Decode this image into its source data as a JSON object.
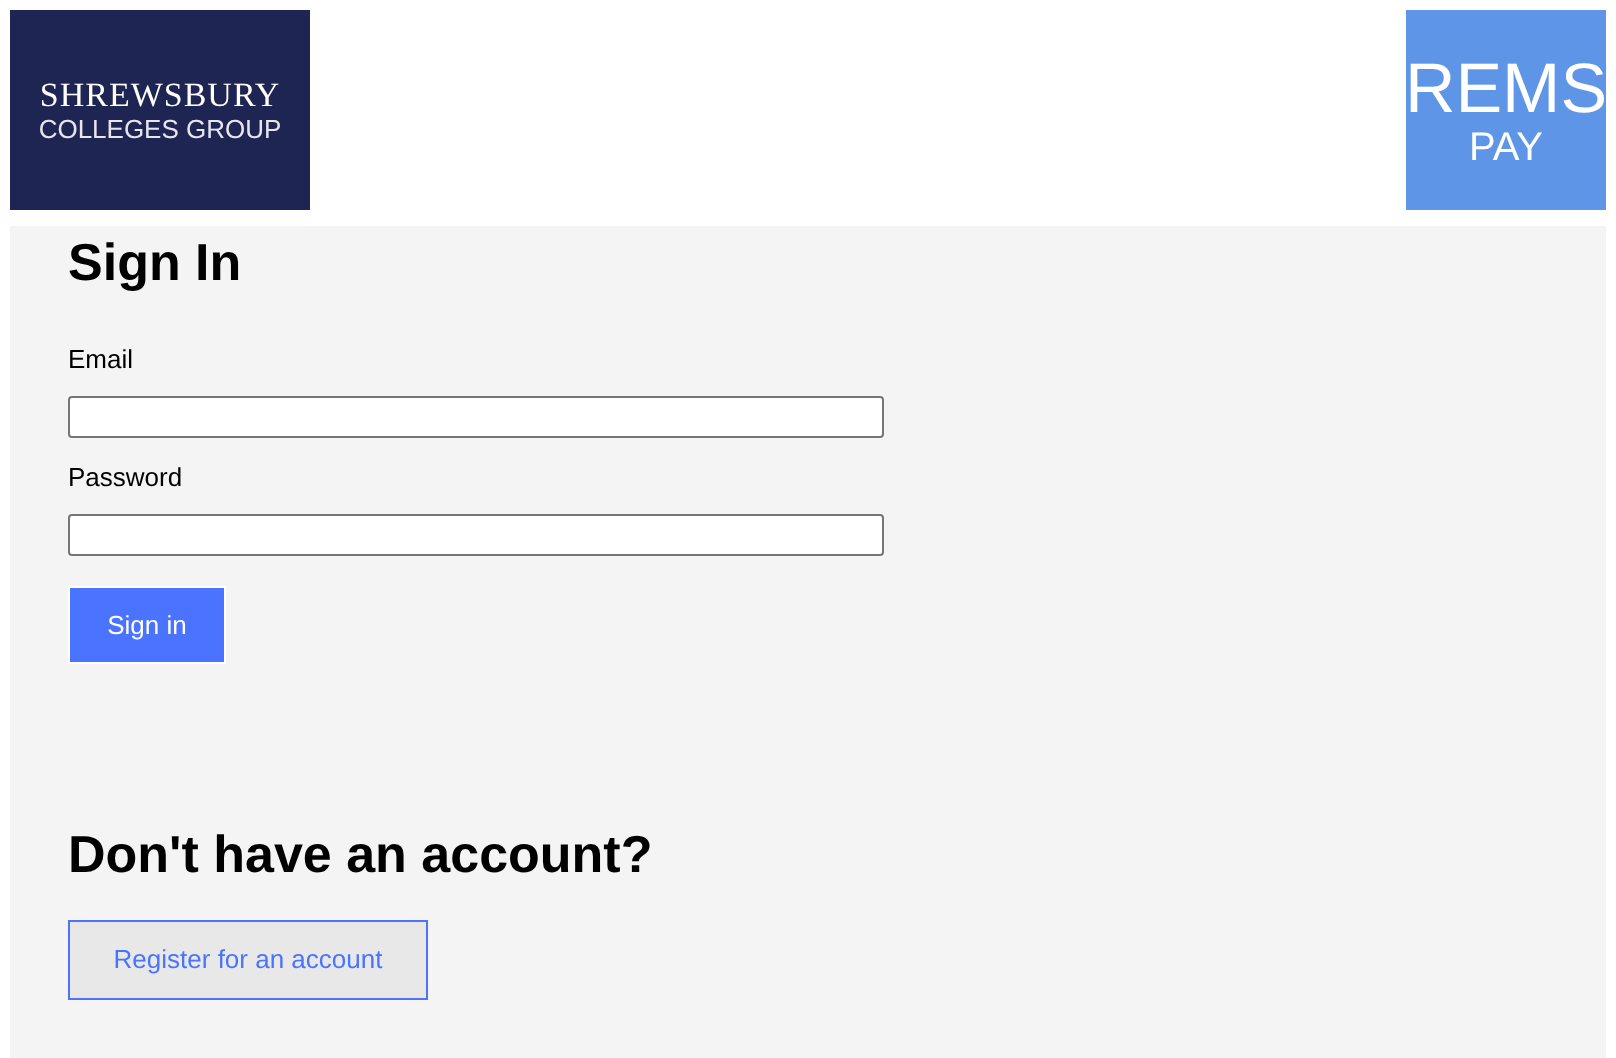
{
  "header": {
    "left_logo": {
      "line_1": "SHREWSBURY",
      "line_2": "COLLEGES GROUP"
    },
    "right_logo": {
      "line_1": "REMS",
      "line_2": "PAY"
    }
  },
  "sign_in": {
    "title": "Sign In",
    "fields": [
      {
        "label": "Email"
      },
      {
        "label": "Password"
      }
    ],
    "button": "Sign in"
  },
  "register": {
    "title": "Don't have an account?",
    "button": "Register for an account"
  }
}
